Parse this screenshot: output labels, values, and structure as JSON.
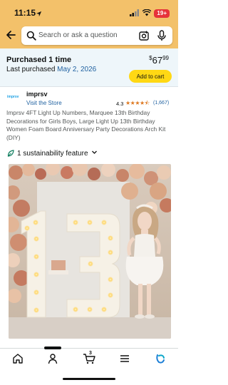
{
  "status_bar": {
    "time": "11:15",
    "battery": "19+"
  },
  "search": {
    "placeholder": "Search or ask a question"
  },
  "purchase": {
    "title": "Purchased 1 time",
    "last_label": "Last purchased",
    "last_date": "May 2, 2026",
    "price_currency": "$",
    "price_whole": "67",
    "price_cents": "99",
    "add_to_cart": "Add to cart"
  },
  "brand": {
    "logo_text": "imprsv",
    "name": "imprsv",
    "visit_store": "Visit the Store",
    "rating": "4.3",
    "stars": "★★★★⯪",
    "rating_count": "(1,667)"
  },
  "product": {
    "title": "Imprsv 4FT Light Up Numbers, Marquee 13th Birthday Decorations for Girls Boys, Large Light Up 13th Birthday Women Foam Board Anniversary Party Decorations Arch Kit (DIY)",
    "sustainability": "1 sustainability feature"
  },
  "bottom_nav": {
    "cart_count": "3"
  },
  "colors": {
    "header": "#f3c16a",
    "link": "#2162a1",
    "add_to_cart": "#ffd814",
    "stars": "#de7921"
  }
}
